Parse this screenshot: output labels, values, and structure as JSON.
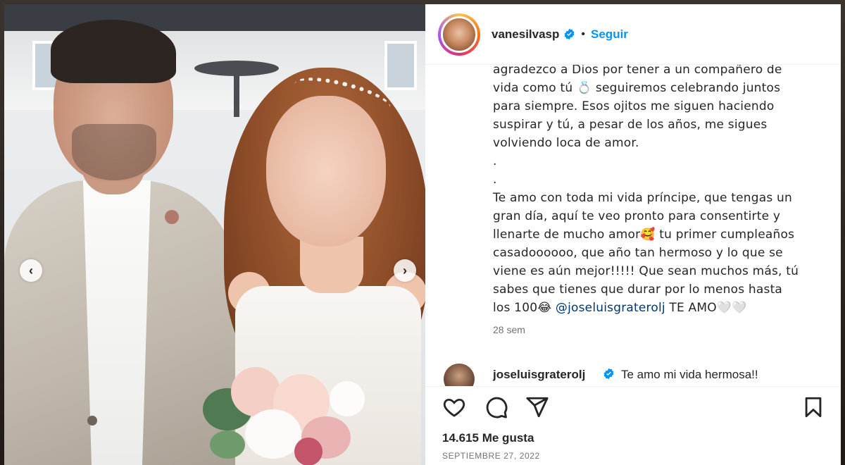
{
  "header": {
    "username": "vanesilvasp",
    "separator": "•",
    "follow_label": "Seguir"
  },
  "caption": {
    "text_before_mention": "agradezco a Dios por tener a un compañero de\nvida como tú 💍 seguiremos celebrando juntos\npara siempre. Esos ojitos me siguen haciendo\nsuspirar y tú, a pesar de los años, me sigues\nvolviendo loca de amor.\n.\n.\nTe amo con toda mi vida príncipe, que tengas un\ngran día, aquí te veo pronto para consentirte y\nllenarte de mucho amor🥰 tu primer cumpleaños\ncasadoooooo, que año tan hermoso y lo que se\nviene es aún mejor!!!!! Que sean muchos más, tú\nsabes que tienes que durar por lo menos hasta\nlos 100😂 ",
    "mention": "@joseluisgraterolj",
    "text_after_mention": " TE AMO🤍🤍",
    "time": "28 sem"
  },
  "comment": {
    "username": "joseluisgraterolj",
    "text": "Te amo mi vida hermosa!!"
  },
  "post": {
    "likes": "14.615 Me gusta",
    "date": "SEPTIEMBRE 27, 2022"
  },
  "icons": {
    "like": "heart-icon",
    "comment": "comment-bubble-icon",
    "share": "paper-plane-icon",
    "save": "bookmark-icon",
    "prev": "chevron-left-icon",
    "next": "chevron-right-icon",
    "verified": "verified-badge-icon"
  },
  "colors": {
    "link": "#0095f6",
    "mention": "#00376b",
    "verified": "#0095f6",
    "muted": "#737373"
  },
  "nav": {
    "prev_glyph": "‹",
    "next_glyph": "›"
  }
}
